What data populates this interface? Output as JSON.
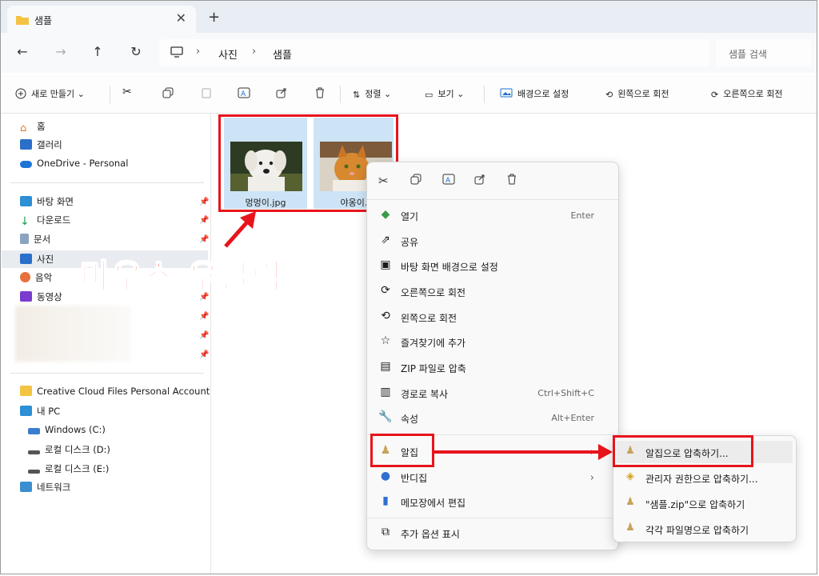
{
  "window": {
    "tab_title": "샘플",
    "new_tab": "+",
    "close": "✕"
  },
  "nav": {
    "back": "←",
    "forward": "→",
    "up": "↑",
    "refresh": "↻",
    "breadcrumb": [
      "사진",
      "샘플"
    ],
    "search_placeholder": "샘플 검색"
  },
  "toolbar": {
    "new": "새로 만들기",
    "sort": "정렬",
    "view": "보기",
    "set_background": "배경으로 설정",
    "rotate_left": "왼쪽으로 회전",
    "rotate_right": "오른쪽으로 회전"
  },
  "sidebar": {
    "quick": [
      {
        "label": "홈",
        "icon": "home-icon"
      },
      {
        "label": "갤러리",
        "icon": "gallery-icon"
      },
      {
        "label": "OneDrive - Personal",
        "icon": "cloud-icon"
      }
    ],
    "pinned": [
      {
        "label": "바탕 화면",
        "icon": "desktop-icon"
      },
      {
        "label": "다운로드",
        "icon": "download-icon"
      },
      {
        "label": "문서",
        "icon": "document-icon"
      },
      {
        "label": "사진",
        "icon": "pictures-icon"
      },
      {
        "label": "음악",
        "icon": "music-icon"
      },
      {
        "label": "동영상",
        "icon": "video-icon"
      }
    ],
    "drives": [
      {
        "label": "Creative Cloud Files Personal Account lif",
        "icon": "folder-icon"
      },
      {
        "label": "내 PC",
        "icon": "pc-icon"
      },
      {
        "label": "Windows (C:)",
        "icon": "drive-icon"
      },
      {
        "label": "로컬 디스크 (D:)",
        "icon": "drive-icon"
      },
      {
        "label": "로컬 디스크 (E:)",
        "icon": "drive-icon"
      },
      {
        "label": "네트워크",
        "icon": "network-icon"
      }
    ]
  },
  "files": [
    {
      "name": "멍멍이.jpg"
    },
    {
      "name": "야옹이.j"
    }
  ],
  "annotation": "마우스 우클릭",
  "context_menu": {
    "items": [
      {
        "label": "열기",
        "shortcut": "Enter",
        "icon": "open-icon"
      },
      {
        "label": "공유",
        "shortcut": "",
        "icon": "share-icon"
      },
      {
        "label": "바탕 화면 배경으로 설정",
        "shortcut": "",
        "icon": "wallpaper-icon"
      },
      {
        "label": "오른쪽으로 회전",
        "shortcut": "",
        "icon": "rotate-right-icon"
      },
      {
        "label": "왼쪽으로 회전",
        "shortcut": "",
        "icon": "rotate-left-icon"
      },
      {
        "label": "즐겨찾기에 추가",
        "shortcut": "",
        "icon": "star-icon"
      },
      {
        "label": "ZIP 파일로 압축",
        "shortcut": "",
        "icon": "zip-icon"
      },
      {
        "label": "경로로 복사",
        "shortcut": "Ctrl+Shift+C",
        "icon": "copy-path-icon"
      },
      {
        "label": "속성",
        "shortcut": "Alt+Enter",
        "icon": "wrench-icon"
      }
    ],
    "alzip": "알집",
    "bandizip": "반디집",
    "notepad": "메모장에서 편집",
    "more": "추가 옵션 표시"
  },
  "submenu": {
    "items": [
      "알집으로 압축하기...",
      "관리자 권한으로 압축하기...",
      "\"샘플.zip\"으로 압축하기",
      "각각 파일명으로 압축하기"
    ]
  }
}
